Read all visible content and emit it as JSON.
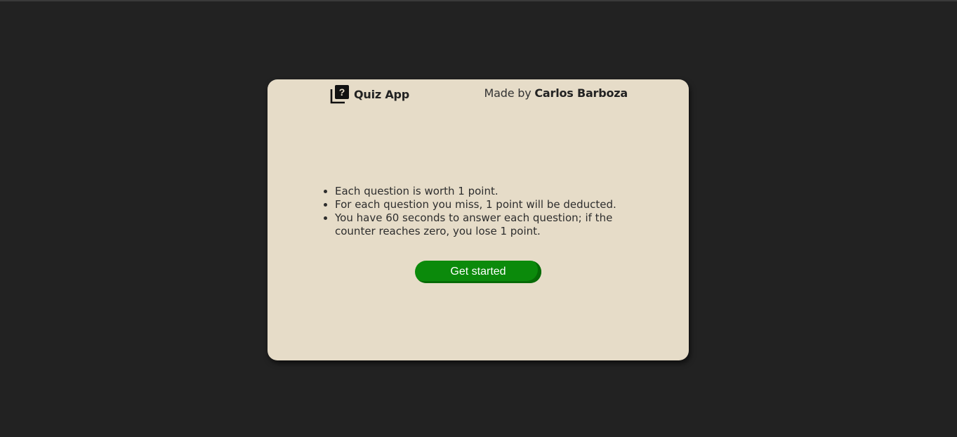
{
  "header": {
    "app_icon": "quiz-question-icon",
    "app_name": "Quiz App",
    "credit_prefix": "Made by",
    "credit_author": "Carlos Barboza"
  },
  "rules": [
    "Each question is worth 1 point.",
    "For each question you miss, 1 point will be deducted.",
    "You have 60 seconds to answer each question; if the counter reaches zero, you lose 1 point."
  ],
  "start_button": {
    "label": "Get started"
  },
  "colors": {
    "page_background": "#222222",
    "card_background": "#e6dcc8",
    "button_background": "#0b8a0b",
    "button_text": "#ffffff"
  }
}
